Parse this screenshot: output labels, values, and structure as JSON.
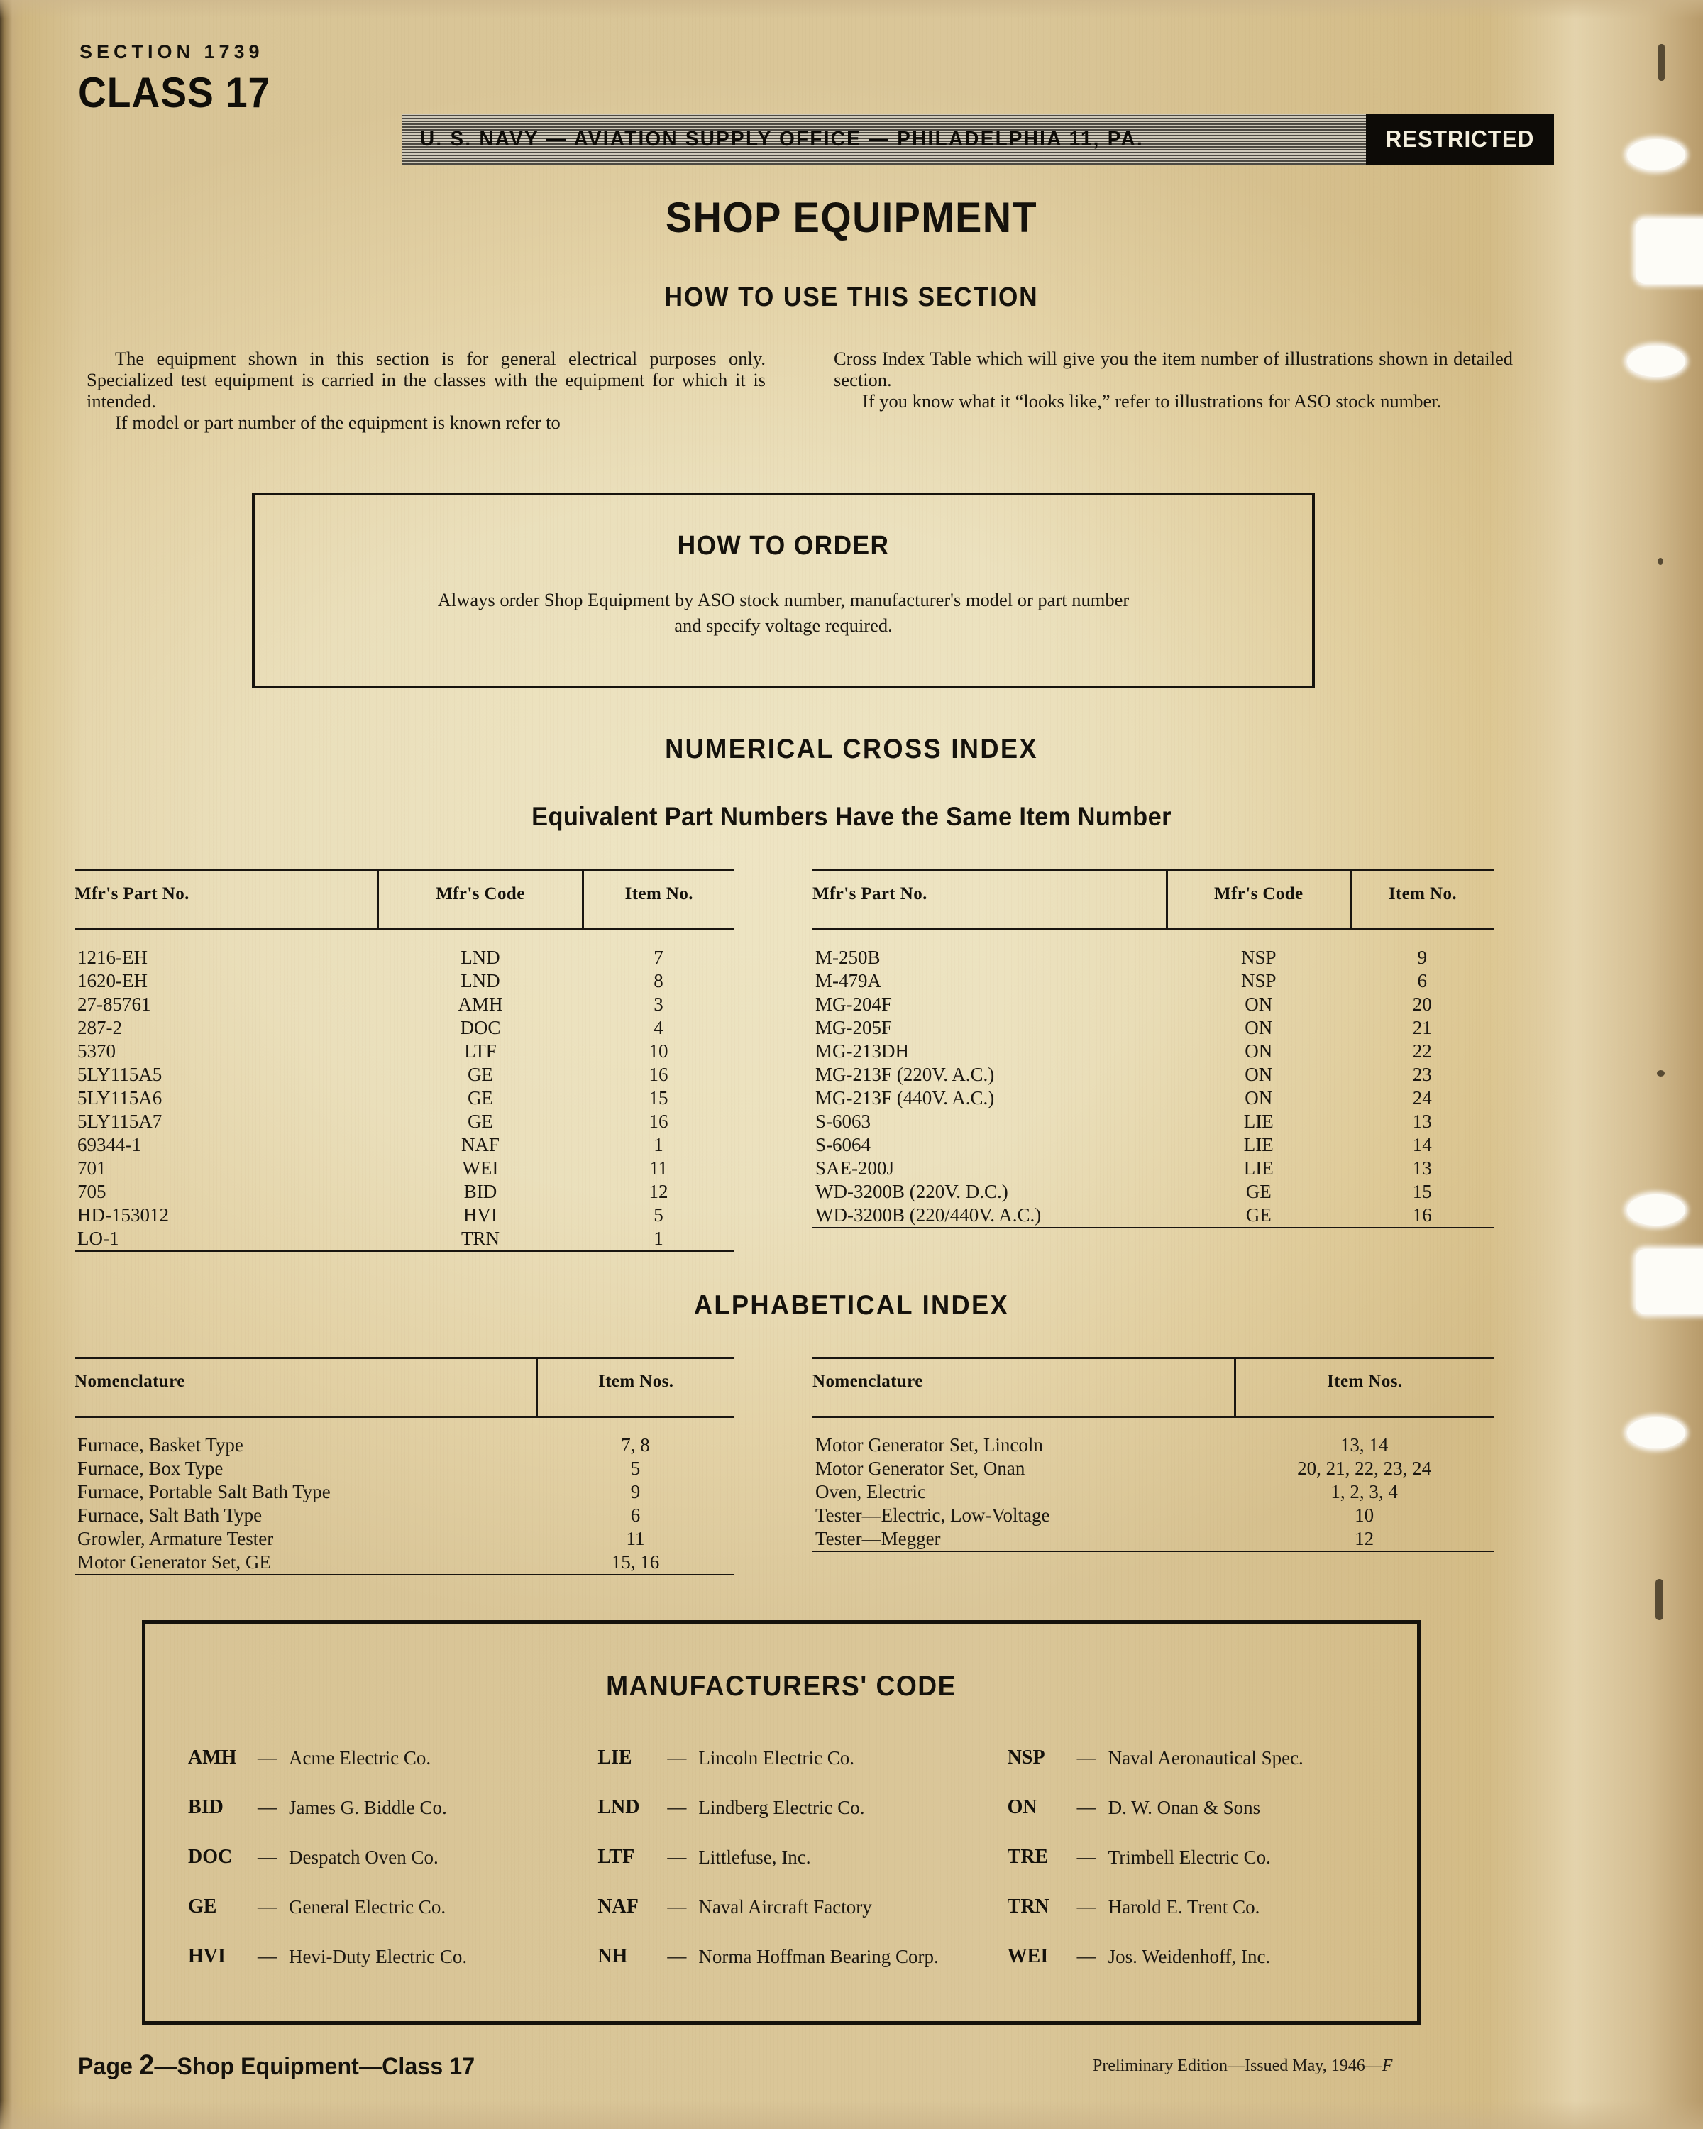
{
  "header": {
    "section": "SECTION 1739",
    "class": "CLASS 17",
    "navy_line": "U. S. NAVY — AVIATION SUPPLY OFFICE — PHILADELPHIA 11, PA.",
    "restricted": "RESTRICTED"
  },
  "titles": {
    "main": "SHOP EQUIPMENT",
    "how_to_use": "HOW TO USE THIS SECTION",
    "numerical_cross_index": "NUMERICAL CROSS INDEX",
    "equivalent_note": "Equivalent Part Numbers Have the Same Item Number",
    "alphabetical_index": "ALPHABETICAL INDEX",
    "manufacturers_code": "MANUFACTURERS' CODE"
  },
  "intro": {
    "left": [
      "The equipment shown in this section is for general electrical purposes only. Specialized test equipment is carried in the classes with the equipment for which it is intended.",
      "If model or part number of the equipment is known refer to"
    ],
    "right": [
      "Cross Index Table which will give you the item number of illustrations shown in detailed section.",
      "If you know what it “looks like,” refer to illustrations for ASO stock number."
    ]
  },
  "order_box": {
    "title": "HOW TO ORDER",
    "body": "Always order Shop Equipment by ASO stock number, manufacturer's model or part number and specify voltage required."
  },
  "cross_index": {
    "columns": [
      "Mfr's Part No.",
      "Mfr's Code",
      "Item No."
    ],
    "left_rows": [
      [
        "1216-EH",
        "LND",
        "7"
      ],
      [
        "1620-EH",
        "LND",
        "8"
      ],
      [
        "27-85761",
        "AMH",
        "3"
      ],
      [
        "287-2",
        "DOC",
        "4"
      ],
      [
        "5370",
        "LTF",
        "10"
      ],
      [
        "5LY115A5",
        "GE",
        "16"
      ],
      [
        "5LY115A6",
        "GE",
        "15"
      ],
      [
        "5LY115A7",
        "GE",
        "16"
      ],
      [
        "69344-1",
        "NAF",
        "1"
      ],
      [
        "701",
        "WEI",
        "11"
      ],
      [
        "705",
        "BID",
        "12"
      ],
      [
        "HD-153012",
        "HVI",
        "5"
      ],
      [
        "LO-1",
        "TRN",
        "1"
      ]
    ],
    "right_rows": [
      [
        "M-250B",
        "NSP",
        "9"
      ],
      [
        "M-479A",
        "NSP",
        "6"
      ],
      [
        "MG-204F",
        "ON",
        "20"
      ],
      [
        "MG-205F",
        "ON",
        "21"
      ],
      [
        "MG-213DH",
        "ON",
        "22"
      ],
      [
        "MG-213F (220V. A.C.)",
        "ON",
        "23"
      ],
      [
        "MG-213F (440V. A.C.)",
        "ON",
        "24"
      ],
      [
        "S-6063",
        "LIE",
        "13"
      ],
      [
        "S-6064",
        "LIE",
        "14"
      ],
      [
        "SAE-200J",
        "LIE",
        "13"
      ],
      [
        "WD-3200B (220V. D.C.)",
        "GE",
        "15"
      ],
      [
        "WD-3200B (220/440V. A.C.)",
        "GE",
        "16"
      ]
    ]
  },
  "alpha_index": {
    "columns": [
      "Nomenclature",
      "Item Nos."
    ],
    "left_rows": [
      [
        "Furnace, Basket Type",
        "7, 8"
      ],
      [
        "Furnace, Box Type",
        "5"
      ],
      [
        "Furnace, Portable Salt Bath Type",
        "9"
      ],
      [
        "Furnace, Salt Bath Type",
        "6"
      ],
      [
        "Growler, Armature Tester",
        "11"
      ],
      [
        "Motor Generator Set, GE",
        "15, 16"
      ]
    ],
    "right_rows": [
      [
        "Motor Generator Set, Lincoln",
        "13, 14"
      ],
      [
        "Motor Generator Set, Onan",
        "20, 21, 22, 23, 24"
      ],
      [
        "Oven, Electric",
        "1, 2, 3, 4"
      ],
      [
        "Tester—Electric, Low-Voltage",
        "10"
      ],
      [
        "Tester—Megger",
        "12"
      ]
    ]
  },
  "manufacturers": {
    "col1": [
      {
        "code": "AMH",
        "dash": "—",
        "name": "Acme Electric Co."
      },
      {
        "code": "BID",
        "dash": "—",
        "name": "James G. Biddle Co."
      },
      {
        "code": "DOC",
        "dash": "—",
        "name": "Despatch Oven Co."
      },
      {
        "code": "GE",
        "dash": "—",
        "name": "General Electric Co."
      },
      {
        "code": "HVI",
        "dash": "—",
        "name": "Hevi-Duty Electric Co."
      }
    ],
    "col2": [
      {
        "code": "LIE",
        "dash": "—",
        "name": "Lincoln Electric Co."
      },
      {
        "code": "LND",
        "dash": "—",
        "name": "Lindberg Electric Co."
      },
      {
        "code": "LTF",
        "dash": "—",
        "name": "Littlefuse, Inc."
      },
      {
        "code": "NAF",
        "dash": "—",
        "name": "Naval Aircraft Factory"
      },
      {
        "code": "NH",
        "dash": "—",
        "name": "Norma Hoffman Bearing Corp."
      }
    ],
    "col3": [
      {
        "code": "NSP",
        "dash": "—",
        "name": "Naval Aeronautical Spec."
      },
      {
        "code": "ON",
        "dash": "—",
        "name": "D. W. Onan & Sons"
      },
      {
        "code": "TRE",
        "dash": "—",
        "name": "Trimbell Electric Co."
      },
      {
        "code": "TRN",
        "dash": "—",
        "name": "Harold E. Trent Co."
      },
      {
        "code": "WEI",
        "dash": "—",
        "name": "Jos. Weidenhoff, Inc."
      }
    ]
  },
  "footer": {
    "page_number": "2",
    "page_prefix": "Page ",
    "page_suffix": "—Shop Equipment—Class 17",
    "edition": "Preliminary Edition—Issued May, 1946—",
    "edition_mark": "F"
  }
}
